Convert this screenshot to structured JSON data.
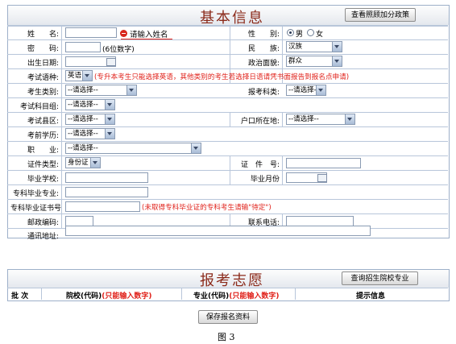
{
  "basic": {
    "title": "基本信息",
    "policy_button": "查看照顾加分政策",
    "name_label": "姓　　名:",
    "name_error": "请输入姓名",
    "gender_label": "性　　别:",
    "gender_options": [
      "男",
      "女"
    ],
    "gender_selected": "男",
    "password_label": "密　　码:",
    "password_hint": "(6位数字)",
    "ethnicity_label": "民　　族:",
    "ethnicity_value": "汉族",
    "birthdate_label": "出生日期:",
    "political_label": "政治面貌:",
    "political_value": "群众",
    "language_label": "考试语种:",
    "language_value": "英语",
    "language_note": "(专升本考生只能选择英语，其他类别的考生若选择日语请凭书面报告到报名点申请)",
    "category_label": "考生类别:",
    "category_value": "--请选择--",
    "subject_label": "报考科类:",
    "subject_value": "--请选择--",
    "exam_group_label": "考试科目组:",
    "exam_group_value": "--请选择--",
    "county_label": "考试县区:",
    "county_value": "--请选择--",
    "household_label": "户口所在地:",
    "household_value": "--请选择--",
    "edu_label": "考前学历:",
    "edu_value": "--请选择--",
    "job_label": "职　　业:",
    "job_value": "--请选择--",
    "idtype_label": "证件类型:",
    "idtype_value": "身份证",
    "idno_label": "证　件　号:",
    "school_label": "毕业学校:",
    "grad_month_label": "毕业月份",
    "major_label": "专科毕业专业:",
    "cert_label": "专科毕业证书号",
    "cert_note": "(未取得专科毕业证的专科考生请输\"待定\")",
    "postcode_label": "邮政编码:",
    "phone_label": "联系电话:",
    "address_label": "通讯地址:"
  },
  "volunteer": {
    "title": "报考志愿",
    "query_button": "查询招生院校专业",
    "col_batch": "批 次",
    "col_school": "院校(代码)",
    "col_school_note": "(只能输入数字)",
    "col_major": "专业(代码)",
    "col_major_note": "(只能输入数字)",
    "col_hint": "提示信息"
  },
  "save_button": "保存报名资料",
  "figure_caption": "图 3",
  "colors": {
    "title": "#8b2a1a",
    "error_red": "#e0211a",
    "border": "#9db0c9"
  }
}
